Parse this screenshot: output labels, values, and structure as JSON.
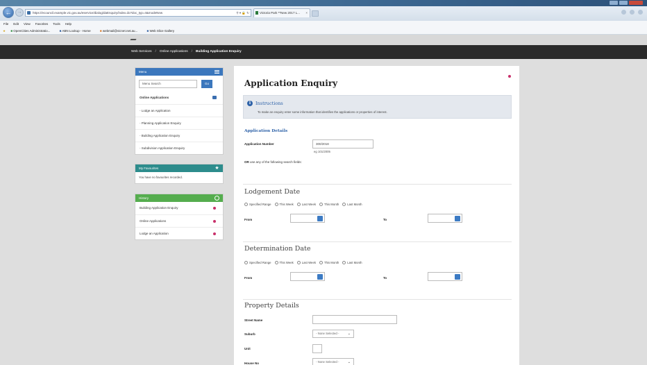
{
  "browser": {
    "url": "https://ecouncil.example.vic.gov.au/eservice/dialog/daEnquiry/index.do?doc_typ=4&modeNew",
    "tab_title": "Victoria Park **New 2017 L...",
    "menu": [
      "File",
      "Edit",
      "View",
      "Favorites",
      "Tools",
      "Help"
    ],
    "favorites": [
      "OpenCities Administratio...",
      "ABN Lookup - Home",
      "webmail@vicnet.net.au...",
      "Web Slice Gallery"
    ]
  },
  "breadcrumb": {
    "items": [
      "Web Services",
      "Online Applications",
      "Building Application Enquiry"
    ],
    "separator": "/"
  },
  "sidebar": {
    "menu": {
      "title": "Menu",
      "search_placeholder": "Menu Search",
      "go_label": "Go",
      "section": "Online Applications",
      "items": [
        "Lodge an Application",
        "Planning Application Enquiry",
        "Building Application Enquiry",
        "Subdivision Application Enquiry"
      ]
    },
    "favourites": {
      "title": "My Favourites",
      "empty_text": "You have no favourites recorded."
    },
    "history": {
      "title": "History",
      "items": [
        "Building Application Enquiry",
        "Online Applications",
        "Lodge an Application"
      ]
    }
  },
  "main": {
    "title": "Application Enquiry",
    "instructions": {
      "title": "Instructions",
      "text": "To make an enquiry enter some information that identifies the applications or properties of interest."
    },
    "application_details": {
      "heading": "Application Details",
      "number_label": "Application Number",
      "number_value": "300/2018",
      "number_hint": "eg 101/2005",
      "or_prefix": "OR",
      "or_text": "use any of the following search fields:"
    },
    "radio_options": [
      "Specified Range",
      "This Week",
      "Last Week",
      "This Month",
      "Last Month"
    ],
    "lodgement": {
      "heading": "Lodgement Date",
      "from_label": "From",
      "to_label": "To"
    },
    "determination": {
      "heading": "Determination Date",
      "from_label": "From",
      "to_label": "To"
    },
    "property": {
      "heading": "Property Details",
      "street_label": "Street Name",
      "suburb_label": "Suburb",
      "suburb_value": "- None Selected -",
      "unit_label": "Unit",
      "house_label": "House No",
      "house_value": "- None Selected -"
    }
  },
  "colors": {
    "nav_bar": "#2a2a2a",
    "menu_header": "#3b77bd",
    "favourites_header": "#2d8c8c",
    "history_header": "#55ad4e",
    "section_heading": "#2e62a8",
    "calendar_button": "#3c7bc4"
  }
}
